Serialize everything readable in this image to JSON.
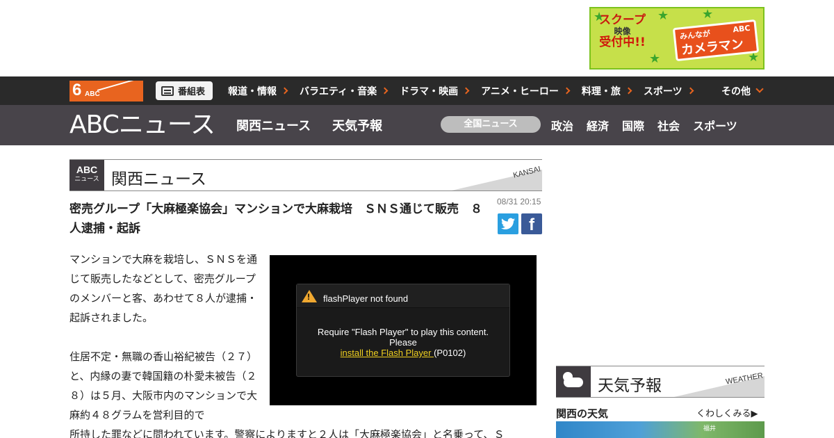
{
  "banner": {
    "left_line1": "スクープ",
    "left_line2": "映像",
    "left_line3": "受付中!!",
    "right_top": "みんなが",
    "right_main": "カメラマン",
    "right_brand": "ABC"
  },
  "nav1": {
    "logo_num": "6",
    "logo_text": "ABC",
    "tv_guide": "番組表",
    "links": [
      "報道・情報",
      "バラエティ・音楽",
      "ドラマ・映画",
      "アニメ・ヒーロー",
      "料理・旅",
      "スポーツ"
    ],
    "more": "その他"
  },
  "nav2": {
    "logo": "ABCニュース",
    "main_links": [
      "関西ニュース",
      "天気予報"
    ],
    "pill": "全国ニュース",
    "categories": [
      "政治",
      "経済",
      "国際",
      "社会",
      "スポーツ"
    ]
  },
  "section": {
    "badge_top": "ABC",
    "badge_bottom": "ニュース",
    "title": "関西ニュース",
    "en": "KANSAI"
  },
  "article": {
    "headline": "密売グループ「大麻極楽協会」マンションで大麻栽培　ＳＮＳ通じて販売　８人逮捕・起訴",
    "date": "08/31 20:15",
    "paragraph1": "マンションで大麻を栽培し、ＳＮＳを通じて販売したなどとして、密売グループのメンバーと客、あわせて８人が逮捕・起訴されました。",
    "paragraph2": "住居不定・無職の香山裕紀被告（２７）と、内縁の妻で韓国籍の朴愛未被告（２８）は５月、大阪市内のマンションで大麻約４８グラムを営利目的で",
    "paragraph3": "所持した罪などに問われています。警察によりますと２人は「大麻極楽協会」と名乗って、Ｓ"
  },
  "player": {
    "title": "flashPlayer not found",
    "msg1": "Require \"Flash Player\" to play this content.",
    "msg2": "Please",
    "link": "install the Flash Player ",
    "code": "(P0102)"
  },
  "weather": {
    "title": "天気予報",
    "en": "WEATHER",
    "subtitle": "関西の天気",
    "more": "くわしくみる▶",
    "city": "福井"
  }
}
